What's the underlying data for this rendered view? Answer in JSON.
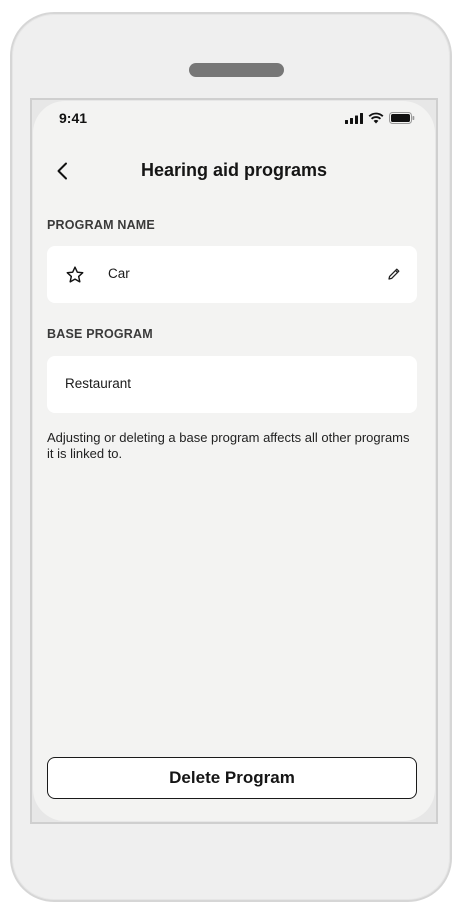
{
  "status_bar": {
    "time": "9:41",
    "icons": [
      "signal-icon",
      "wifi-icon",
      "battery-icon"
    ]
  },
  "nav": {
    "back_icon": "chevron-left-icon",
    "title": "Hearing aid programs"
  },
  "program_name": {
    "label": "PROGRAM NAME",
    "value": "Car",
    "icon": "star-outline-icon",
    "edit_icon": "pencil-icon"
  },
  "base_program": {
    "label": "BASE PROGRAM",
    "value": "Restaurant"
  },
  "info": {
    "text": "Adjusting or deleting a base program affects all other programs it is linked to."
  },
  "actions": {
    "delete_label": "Delete Program"
  }
}
